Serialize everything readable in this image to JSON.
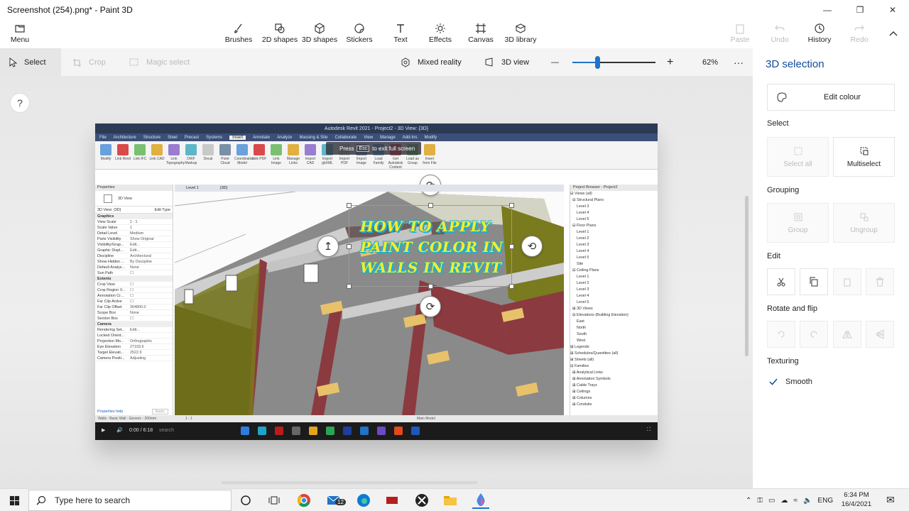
{
  "window": {
    "title": "Screenshot (254).png* - Paint 3D",
    "minimize": "—",
    "maximize": "❐",
    "close": "✕"
  },
  "ribbon": {
    "menu": "Menu",
    "brushes": "Brushes",
    "shapes2d": "2D shapes",
    "shapes3d": "3D shapes",
    "stickers": "Stickers",
    "text": "Text",
    "effects": "Effects",
    "canvas": "Canvas",
    "library3d": "3D library",
    "paste": "Paste",
    "undo": "Undo",
    "history": "History",
    "redo": "Redo"
  },
  "toolbar": {
    "select": "Select",
    "crop": "Crop",
    "magic_select": "Magic select",
    "mixed_reality": "Mixed reality",
    "view3d": "3D view",
    "zoom_minus": "—",
    "zoom_plus": "+",
    "zoom_level": "62%",
    "zoom_fraction": 0.3,
    "more": "···"
  },
  "canvas": {
    "help": "?"
  },
  "overlay": {
    "line1": "HOW TO APPLY",
    "line2": "PAINT COLOR  IN",
    "line3": "WALLS IN REVIT"
  },
  "revit": {
    "title": "Autodesk Revit 2021 - Project2 - 3D View: {3D}",
    "tabs": [
      "File",
      "Architecture",
      "Structure",
      "Steel",
      "Precast",
      "Systems",
      "Insert",
      "Annotate",
      "Analyze",
      "Massing & Site",
      "Collaborate",
      "View",
      "Manage",
      "Add-Ins",
      "Modify"
    ],
    "active_tab": "Insert",
    "tools": [
      "Modify",
      "Link Revit",
      "Link IFC",
      "Link CAD",
      "Link Topography",
      "DWF Markup",
      "Decal",
      "Point Cloud",
      "Coordination Model",
      "Link PDF",
      "Link Image",
      "Manage Links",
      "Import CAD",
      "Import gbXML",
      "Import PDF",
      "Import Image",
      "Load Family",
      "Get Autodesk Content",
      "Load as Group",
      "Insert from File"
    ],
    "press_msg": {
      "pre": "Press",
      "key": "Esc",
      "post": "to exit full screen"
    },
    "props_title": "Properties",
    "view_type": "3D View",
    "view_label": "3D View: {3D}",
    "edit_type": "Edit Type",
    "props": [
      {
        "k": "Graphics",
        "v": "",
        "g": true
      },
      {
        "k": "View Scale",
        "v": "1 : 1"
      },
      {
        "k": "Scale Value",
        "v": "1"
      },
      {
        "k": "Detail Level",
        "v": "Medium"
      },
      {
        "k": "Parts Visibility",
        "v": "Show Original"
      },
      {
        "k": "Visibility/Grap...",
        "v": "Edit..."
      },
      {
        "k": "Graphic Displ...",
        "v": "Edit..."
      },
      {
        "k": "Discipline",
        "v": "Architectural"
      },
      {
        "k": "Show Hidden ...",
        "v": "By Discipline"
      },
      {
        "k": "Default Analys...",
        "v": "None"
      },
      {
        "k": "Sun Path",
        "v": "☐"
      },
      {
        "k": "Extents",
        "v": "",
        "g": true
      },
      {
        "k": "Crop View",
        "v": "☐"
      },
      {
        "k": "Crop Region V...",
        "v": "☐"
      },
      {
        "k": "Annotation Cr...",
        "v": "☐"
      },
      {
        "k": "Far Clip Active",
        "v": "☐"
      },
      {
        "k": "Far Clip Offset",
        "v": "304800.0"
      },
      {
        "k": "Scope Box",
        "v": "None"
      },
      {
        "k": "Section Box",
        "v": "☐"
      },
      {
        "k": "Camera",
        "v": "",
        "g": true
      },
      {
        "k": "Rendering Set...",
        "v": "Edit..."
      },
      {
        "k": "Locked Orient...",
        "v": ""
      },
      {
        "k": "Projection Mo...",
        "v": "Orthographic"
      },
      {
        "k": "Eye Elevation",
        "v": "27193.6"
      },
      {
        "k": "Target Elevati...",
        "v": "2522.9"
      },
      {
        "k": "Camera Positi...",
        "v": "Adjusting"
      }
    ],
    "props_help": "Properties help",
    "apply": "Apply",
    "view_tabs": [
      "Level 1",
      "{3D}"
    ],
    "browser_title": "Project Browser - Project2",
    "browser": [
      "⊟ Views (all)",
      "  ⊟ Structural Plans",
      "      Level 3",
      "      Level 4",
      "      Level 5",
      "  ⊟ Floor Plans",
      "      Level 1",
      "      Level 2",
      "      Level 3",
      "      Level 4",
      "      Level 5",
      "      Site",
      "  ⊟ Ceiling Plans",
      "      Level 1",
      "      Level 2",
      "      Level 3",
      "      Level 4",
      "      Level 5",
      "  ⊞ 3D Views",
      "  ⊟ Elevations (Building Elevation)",
      "      East",
      "      North",
      "      South",
      "      West",
      "⊞ Legends",
      "⊞ Schedules/Quantities (all)",
      "⊞ Sheets (all)",
      "⊟ Families",
      "  ⊞ Analytical Links",
      "  ⊞ Annotation Symbols",
      "  ⊞ Cable Trays",
      "  ⊞ Ceilings",
      "  ⊞ Columns",
      "  ⊞ Conduits"
    ],
    "status": "Walls : Basic Wall : Generic - 200mm",
    "scale": "1 : 1",
    "main_model": "Main Model",
    "player_time": "0:00 / 6:18",
    "player_search": "search"
  },
  "panel": {
    "title": "3D selection",
    "edit_colour": "Edit colour",
    "select_h": "Select",
    "select_all": "Select all",
    "multiselect": "Multiselect",
    "grouping_h": "Grouping",
    "group": "Group",
    "ungroup": "Ungroup",
    "edit_h": "Edit",
    "rotate_h": "Rotate and flip",
    "texturing_h": "Texturing",
    "smooth": "Smooth",
    "smooth_checked": true
  },
  "taskbar": {
    "search_placeholder": "Type here to search",
    "mail_badge": "12",
    "lang": "ENG",
    "time": "6:34 PM",
    "date": "16/4/2021"
  },
  "colors": {
    "accent": "#0f4c9a",
    "slider": "#1f73c8",
    "overlay_text": "#f7ec2a",
    "overlay_outline": "#1ab1cf",
    "wall": "#8b3a3f",
    "glass": "#7a7a1e"
  }
}
